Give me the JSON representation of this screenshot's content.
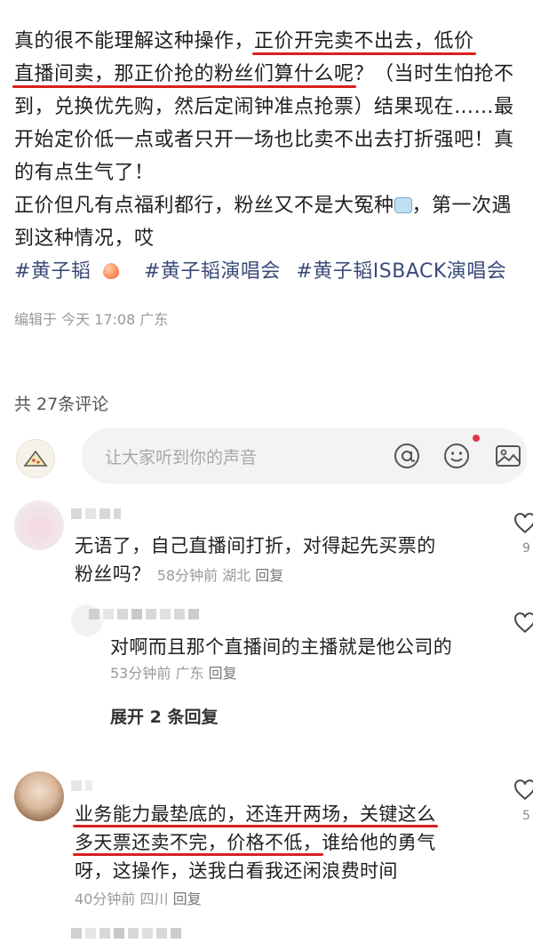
{
  "post": {
    "paragraph1_parts": [
      "真的很不能理解这种操作，",
      "正价开完卖不出去，低价",
      "直播间卖，那正价抢的粉丝们算什么呢",
      "？（当时生怕抢不到，兑换优先购，然后定闹钟准点抢票）结果现在……最开始定价低一点或者只开一场也比卖不出去打折强吧！真的有点生气了！"
    ],
    "paragraph2_a": "正价但凡有点福利都行，粉丝又不是大冤种",
    "paragraph2_b": "，第一次遇到这种情况，哎",
    "emoji_face": "face-emoji",
    "hashtags": [
      "#黄子韬",
      "#黄子韬演唱会",
      "#黄子韬ISBACK演唱会"
    ],
    "peach_icon": "peach-emoji",
    "edit_meta": "编辑于 今天 17:08 广东"
  },
  "comments_count": "共 27条评论",
  "input": {
    "placeholder": "让大家听到你的声音",
    "icons": [
      "at-icon",
      "emoji-icon",
      "image-icon"
    ]
  },
  "comments": [
    {
      "text_a": "无语了，自己直播间打折，对得起先买票的",
      "text_b": "粉丝吗？",
      "meta_time": "58分钟前",
      "meta_loc": "湖北",
      "reply": "回复",
      "likes": "9"
    },
    {
      "text": "对啊而且那个直播间的主播就是他公司的",
      "meta_time": "53分钟前",
      "meta_loc": "广东",
      "reply": "回复"
    },
    {
      "text_a": "业务能力最垫底的，还连开两场，关键这么",
      "text_b": "多天票还卖不完，价格不低，",
      "text_b2": "谁给他的勇气",
      "text_c": "呀，这操作，送我白看我还闲浪费时间",
      "meta_time": "40分钟前",
      "meta_loc": "四川",
      "reply": "回复",
      "likes": "5"
    }
  ],
  "expand_label": "展开 2 条回复",
  "colors": {
    "underline": "#d9201f",
    "hashtag": "#3a4a78",
    "meta": "#9a9a9a"
  }
}
